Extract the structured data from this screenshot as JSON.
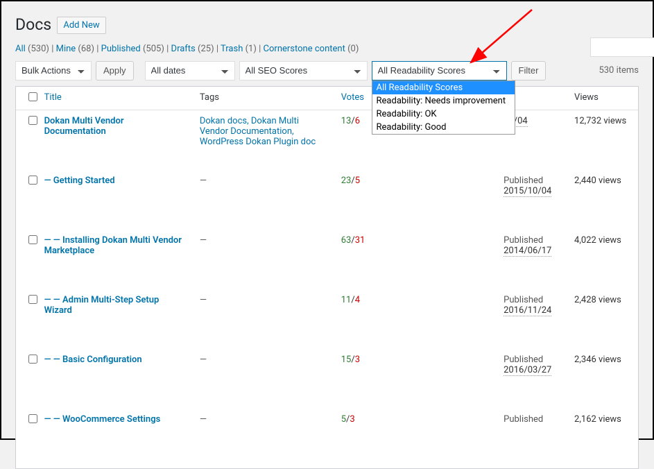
{
  "page": {
    "title": "Docs",
    "add_new": "Add New"
  },
  "filters": {
    "links": [
      {
        "label": "All",
        "count": "(530)"
      },
      {
        "label": "Mine",
        "count": "(68)"
      },
      {
        "label": "Published",
        "count": "(505)"
      },
      {
        "label": "Drafts",
        "count": "(25)"
      },
      {
        "label": "Trash",
        "count": "(1)"
      },
      {
        "label": "Cornerstone content",
        "count": "(0)"
      }
    ],
    "bulk_actions": "Bulk Actions",
    "apply": "Apply",
    "all_dates": "All dates",
    "all_seo": "All SEO Scores",
    "readability": {
      "selected": "All Readability Scores",
      "options": [
        "All Readability Scores",
        "Readability: Needs improvement",
        "Readability: OK",
        "Readability: Good"
      ]
    },
    "filter_button": "Filter",
    "items_count": "530 items"
  },
  "columns": {
    "title": "Title",
    "tags": "Tags",
    "votes": "Votes",
    "views": "Views"
  },
  "rows": [
    {
      "title": "Dokan Multi Vendor Documentation",
      "tags": "Dokan docs, Dokan Multi Vendor Documentation, WordPress Dokan Plugin doc",
      "votes_pos": "13",
      "votes_neg": "6",
      "status": "",
      "date": "10/04",
      "views": "12,732 views"
    },
    {
      "title": "— Getting Started",
      "tags": "—",
      "votes_pos": "23",
      "votes_neg": "5",
      "status": "Published",
      "date": "2015/10/04",
      "views": "2,440 views"
    },
    {
      "title": "— — Installing Dokan Multi Vendor Marketplace",
      "tags": "—",
      "votes_pos": "63",
      "votes_neg": "31",
      "status": "Published",
      "date": "2014/06/17",
      "views": "4,022 views"
    },
    {
      "title": "— — Admin Multi-Step Setup Wizard",
      "tags": "—",
      "votes_pos": "11",
      "votes_neg": "4",
      "status": "Published",
      "date": "2016/11/24",
      "views": "2,428 views"
    },
    {
      "title": "— — Basic Configuration",
      "tags": "—",
      "votes_pos": "15",
      "votes_neg": "3",
      "status": "Published",
      "date": "2016/03/27",
      "views": "2,346 views"
    },
    {
      "title": "— — WooCommerce Settings",
      "tags": "—",
      "votes_pos": "5",
      "votes_neg": "3",
      "status": "Published",
      "date": "",
      "views": "2,162 views"
    }
  ]
}
